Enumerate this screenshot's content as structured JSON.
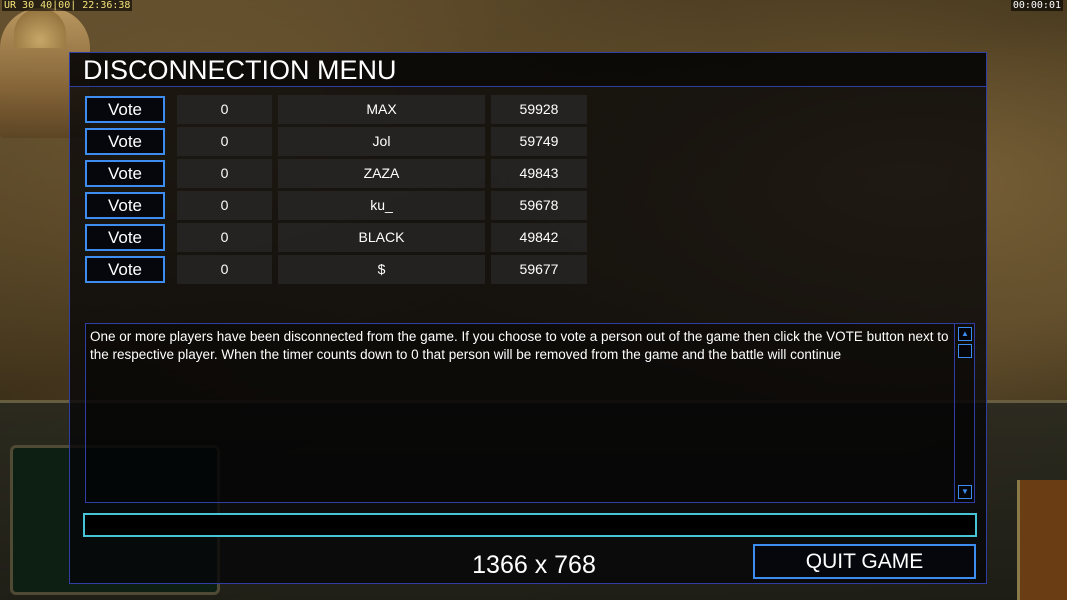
{
  "hud": {
    "top_left": "UR 30 40|00| 22:36:38",
    "top_right": "00:00:01"
  },
  "dialog": {
    "title": "DISCONNECTION MENU",
    "vote_label": "Vote",
    "players": [
      {
        "count": "0",
        "name": "MAX",
        "id": "59928"
      },
      {
        "count": "0",
        "name": "Jol",
        "id": "59749"
      },
      {
        "count": "0",
        "name": "ZAZA",
        "id": "49843"
      },
      {
        "count": "0",
        "name": "ku_",
        "id": "59678"
      },
      {
        "count": "0",
        "name": "BLACK",
        "id": "49842"
      },
      {
        "count": "0",
        "name": "$",
        "id": "59677"
      }
    ],
    "message": "One or more players have been disconnected from the game. If you choose to vote a person out of the game then click the VOTE button next to the respective player. When the timer counts down to 0 that person will be removed from the game and the battle will continue",
    "chat_value": "",
    "quit_label": "QUIT GAME",
    "resolution": "1366 x 768"
  },
  "colors": {
    "accent_blue": "#3d8cf0",
    "chat_border": "#46c4d6",
    "frame": "#2f3ea0"
  }
}
